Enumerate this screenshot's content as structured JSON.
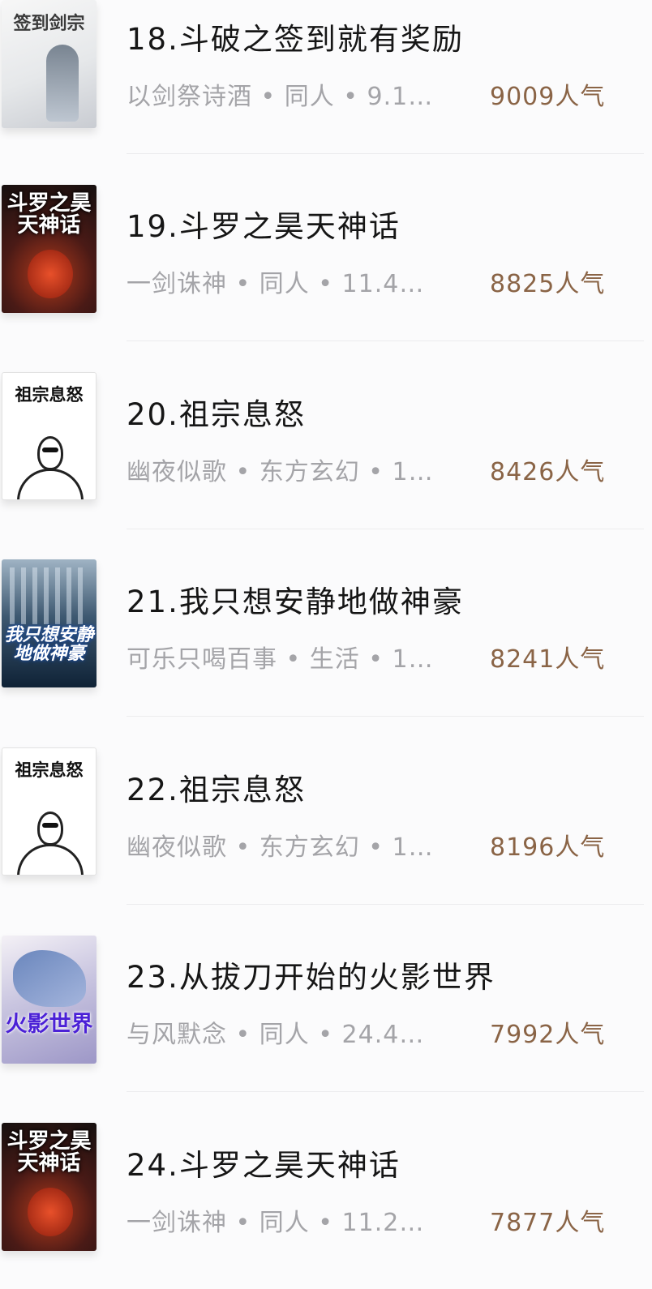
{
  "books": [
    {
      "cover_icon": "book-cover-sword-image",
      "cover_text": "签到剑宗",
      "title": "18.斗破之签到就有奖励",
      "meta": "以剑祭诗酒 • 同人 • 9.1…",
      "popularity": "9009人气"
    },
    {
      "cover_icon": "book-cover-douluo-image",
      "cover_text": "斗罗之昊天神话",
      "title": "19.斗罗之昊天神话",
      "meta": "一剑诛神 • 同人 • 11.4…",
      "popularity": "8825人气"
    },
    {
      "cover_icon": "book-cover-zuzong-image",
      "cover_text": "祖宗息怒",
      "title": "20.祖宗息怒",
      "meta": "幽夜似歌 • 东方玄幻 • 1…",
      "popularity": "8426人气"
    },
    {
      "cover_icon": "book-cover-shenhao-image",
      "cover_text": "我只想安静地做神豪",
      "title": "21.我只想安静地做神豪",
      "meta": "可乐只喝百事 • 生活 • 1…",
      "popularity": "8241人气"
    },
    {
      "cover_icon": "book-cover-zuzong-image",
      "cover_text": "祖宗息怒",
      "title": "22.祖宗息怒",
      "meta": "幽夜似歌 • 东方玄幻 • 1…",
      "popularity": "8196人气"
    },
    {
      "cover_icon": "book-cover-huoying-image",
      "cover_text": "火影世界",
      "title": "23.从拔刀开始的火影世界",
      "meta": "与风默念 • 同人 • 24.4…",
      "popularity": "7992人气"
    },
    {
      "cover_icon": "book-cover-douluo-image",
      "cover_text": "斗罗之昊天神话",
      "title": "24.斗罗之昊天神话",
      "meta": "一剑诛神 • 同人 • 11.2…",
      "popularity": "7877人气"
    }
  ]
}
